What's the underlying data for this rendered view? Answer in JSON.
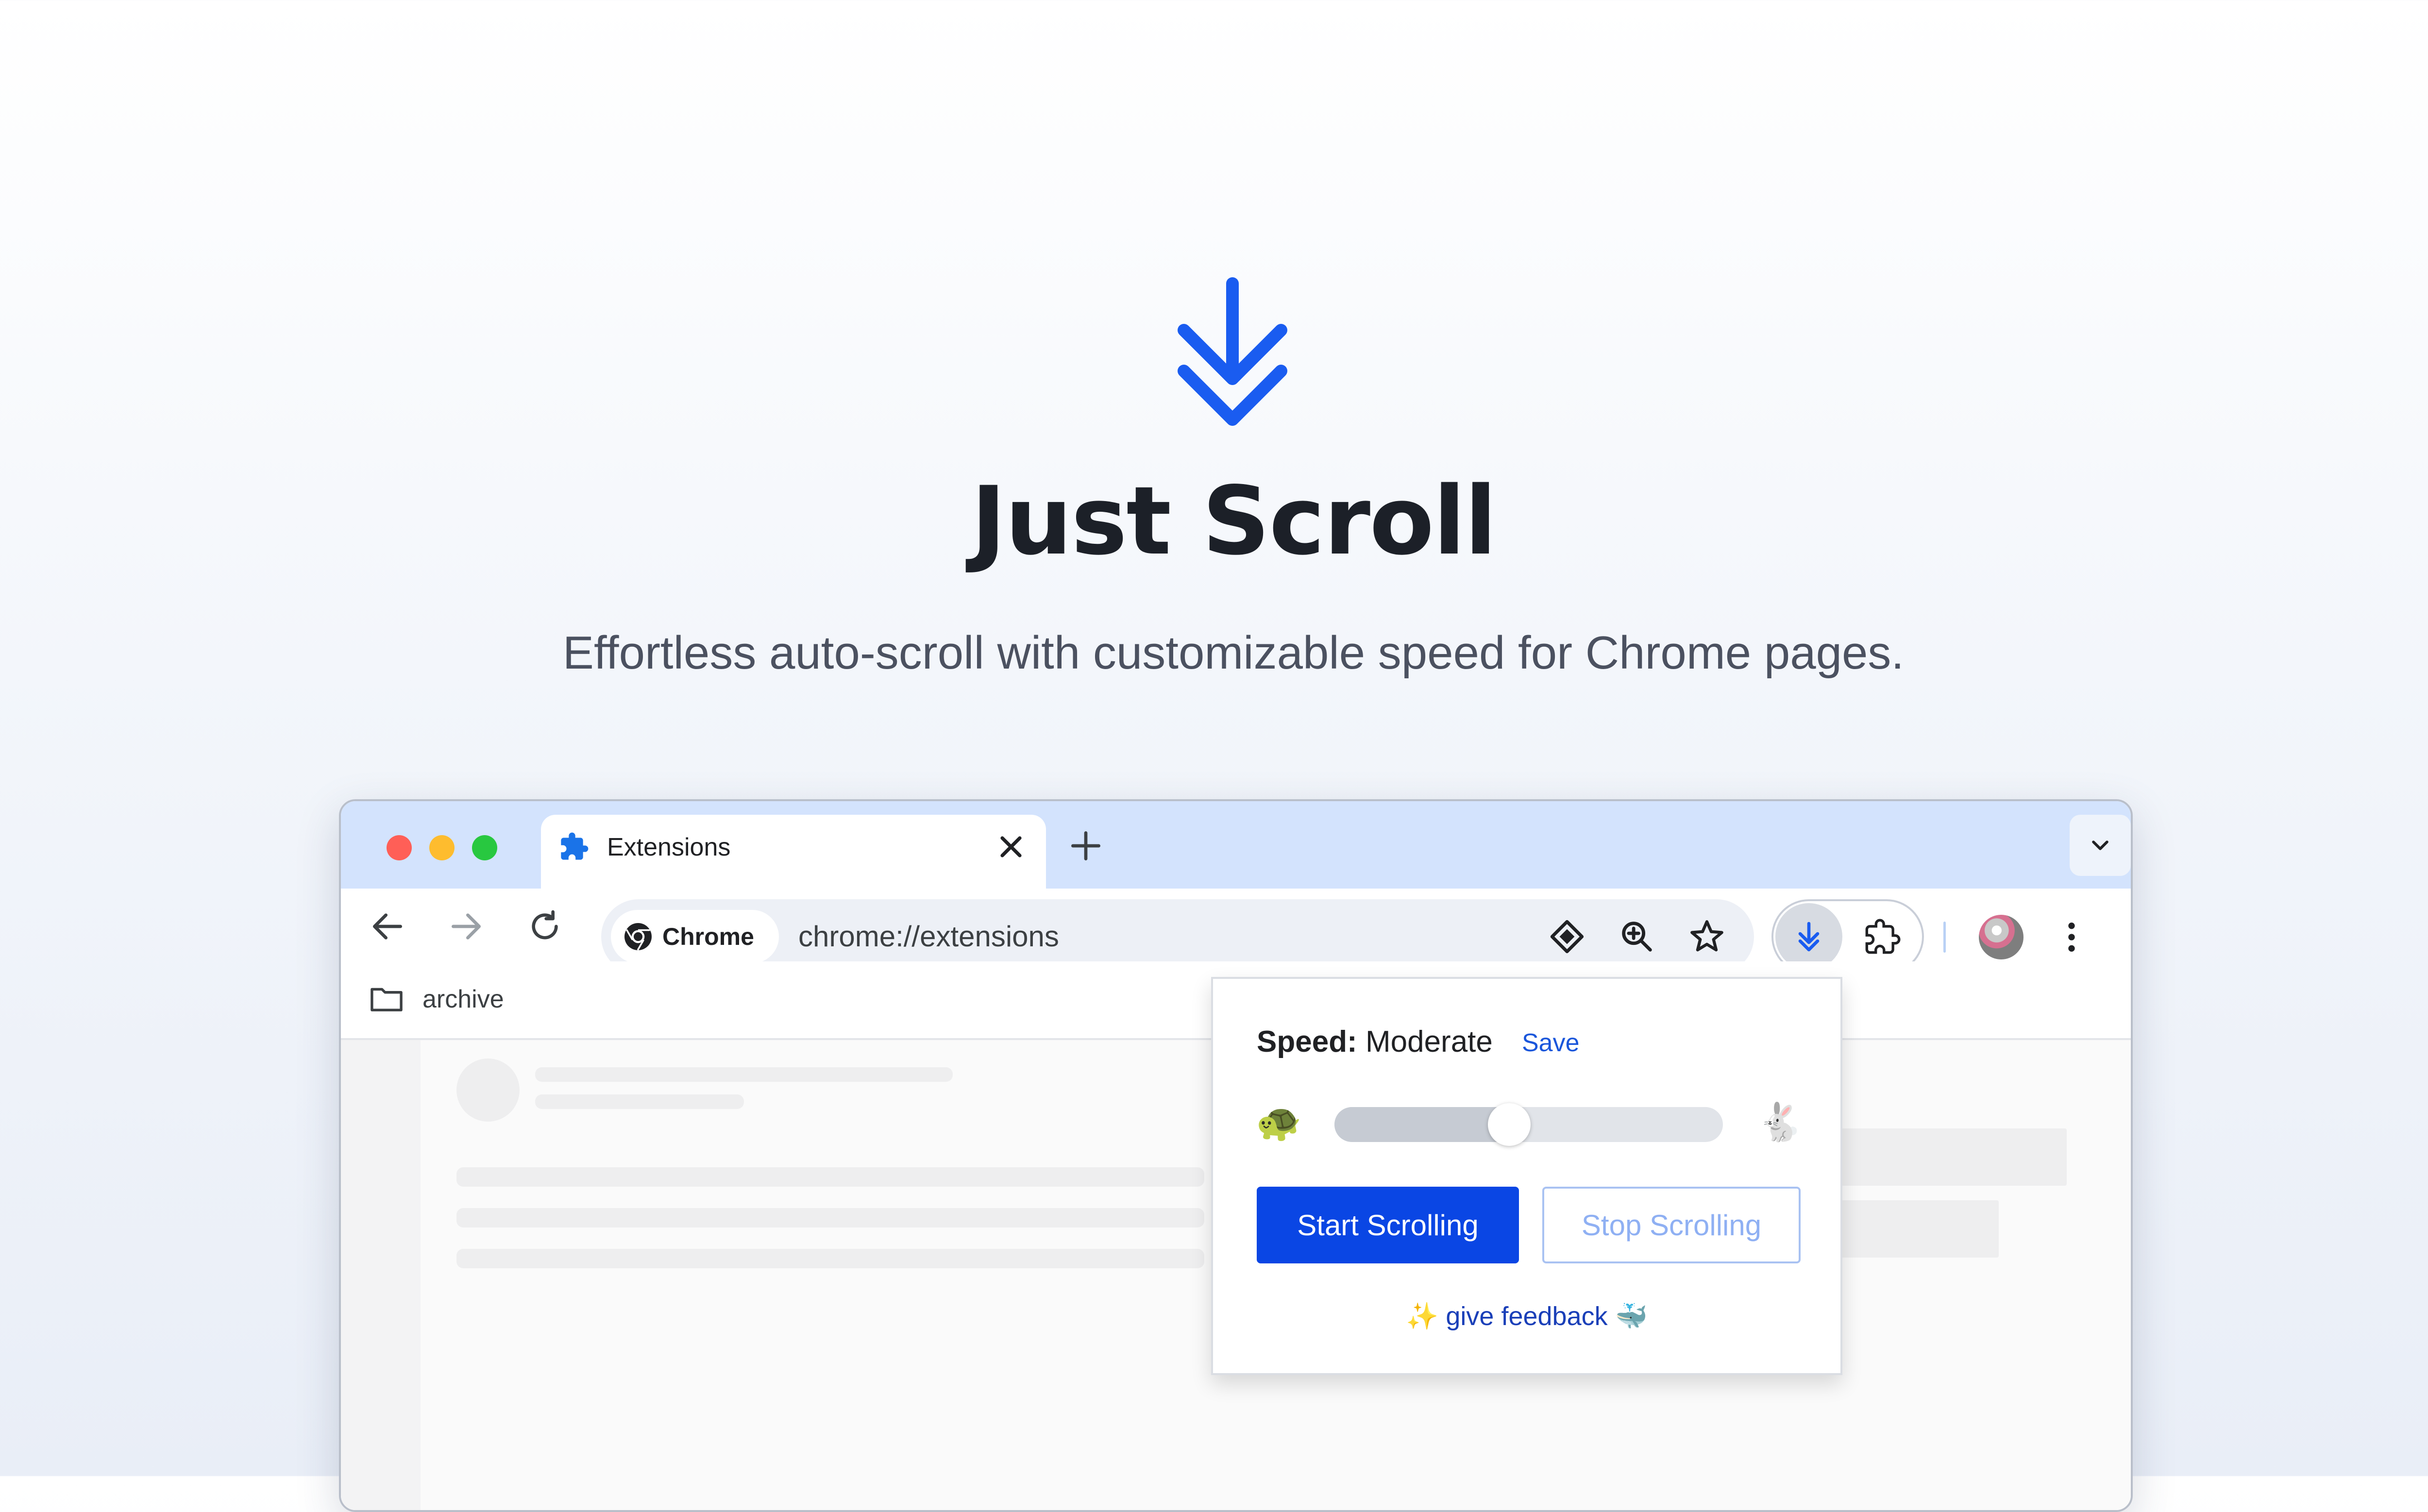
{
  "hero": {
    "icon": "double-down-arrow-icon",
    "title": "Just Scroll",
    "subtitle": "Effortless auto-scroll with customizable speed for Chrome pages."
  },
  "browser": {
    "tab": {
      "icon": "puzzle-icon",
      "title": "Extensions",
      "close_icon": "close-icon"
    },
    "new_tab_icon": "plus-icon",
    "tab_search_icon": "chevron-down-icon",
    "nav": {
      "back_icon": "arrow-left-icon",
      "forward_icon": "arrow-right-icon",
      "reload_icon": "reload-icon"
    },
    "omnibox": {
      "chip_label": "Chrome",
      "chip_icon": "chrome-logo-icon",
      "url": "chrome://extensions",
      "icons": [
        "lens-icon",
        "zoom-icon",
        "star-icon"
      ]
    },
    "extensions": {
      "active_icon": "just-scroll-arrow-icon",
      "menu_icon": "puzzle-outline-icon"
    },
    "profile_icon": "avatar",
    "menu_icon": "kebab-menu-icon",
    "bookmarks": [
      {
        "icon": "folder-icon",
        "label": "archive"
      }
    ]
  },
  "popup": {
    "speed_label": "Speed:",
    "speed_value": "Moderate",
    "save_label": "Save",
    "slow_emoji": "🐢",
    "fast_emoji": "🐇",
    "slider_value": 0.45,
    "start_label": "Start Scrolling",
    "stop_label": "Stop Scrolling",
    "feedback_prefix": "✨",
    "feedback_label": "give feedback",
    "feedback_suffix": "🐳",
    "colors": {
      "primary": "#0a46e4",
      "link": "#1a56db",
      "disabled_text": "#8fb0f3"
    }
  }
}
